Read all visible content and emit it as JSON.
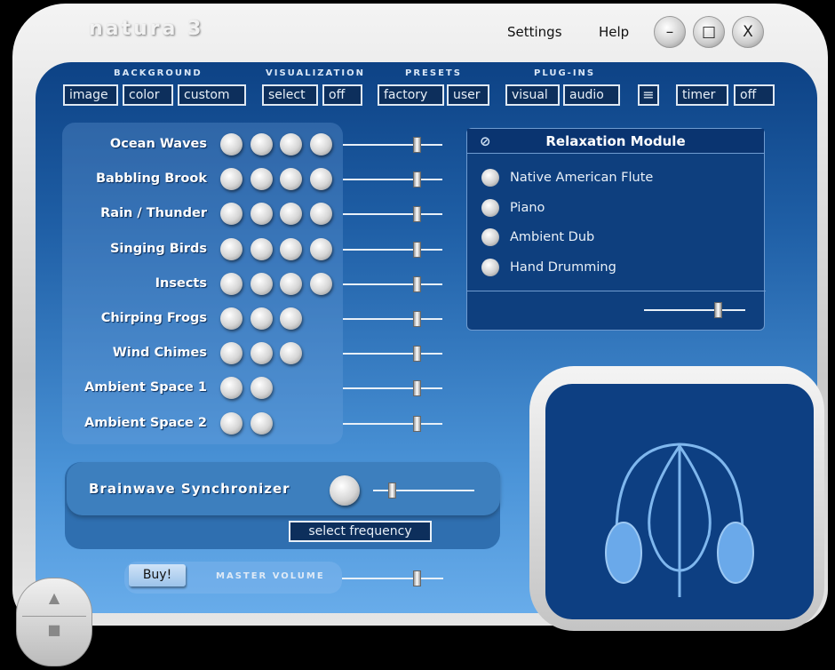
{
  "window": {
    "title": "natura 3",
    "menu": [
      "Settings",
      "Help"
    ],
    "controls": {
      "minimize": "–",
      "maximize": "□",
      "close": "X"
    }
  },
  "toolbar": {
    "groups": [
      {
        "label": "BACKGROUND",
        "buttons": [
          "image",
          "color",
          "custom"
        ]
      },
      {
        "label": "VISUALIZATION",
        "buttons": [
          "select",
          "off"
        ]
      },
      {
        "label": "PRESETS",
        "buttons": [
          "factory",
          "user"
        ]
      },
      {
        "label": "PLUG-INS",
        "buttons": [
          "visual",
          "audio"
        ]
      }
    ],
    "list_icon": "list-icon",
    "timer": [
      "timer",
      "off"
    ]
  },
  "sounds": [
    {
      "label": "Ocean Waves",
      "variants": 4,
      "volume": 0.74
    },
    {
      "label": "Babbling Brook",
      "variants": 4,
      "volume": 0.74
    },
    {
      "label": "Rain / Thunder",
      "variants": 4,
      "volume": 0.74
    },
    {
      "label": "Singing Birds",
      "variants": 4,
      "volume": 0.74
    },
    {
      "label": "Insects",
      "variants": 4,
      "volume": 0.74
    },
    {
      "label": "Chirping Frogs",
      "variants": 3,
      "volume": 0.74
    },
    {
      "label": "Wind Chimes",
      "variants": 3,
      "volume": 0.74
    },
    {
      "label": "Ambient Space 1",
      "variants": 2,
      "volume": 0.74
    },
    {
      "label": "Ambient Space 2",
      "variants": 2,
      "volume": 0.74
    }
  ],
  "relaxation": {
    "title": "Relaxation Module",
    "items": [
      "Native American Flute",
      "Piano",
      "Ambient Dub",
      "Hand Drumming"
    ],
    "volume": 0.73
  },
  "brainwave": {
    "label": "Brainwave Synchronizer",
    "level": 0.18,
    "button": "select frequency"
  },
  "footer": {
    "buy": "Buy!",
    "master_label": "MASTER VOLUME",
    "master_volume": 0.74
  },
  "transport": {
    "play": "▲",
    "stop": "■"
  }
}
